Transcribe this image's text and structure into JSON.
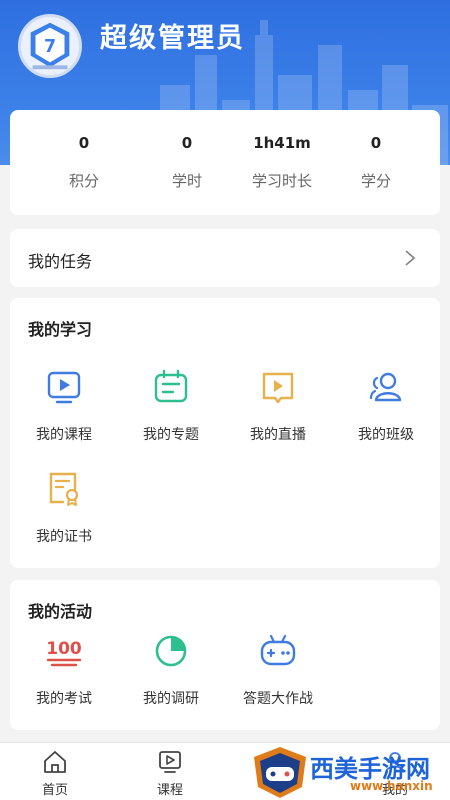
{
  "user": {
    "name": "超级管理员"
  },
  "stats": [
    {
      "value": "0",
      "label": "积分"
    },
    {
      "value": "0",
      "label": "学时"
    },
    {
      "value": "1h41m",
      "label": "学习时长"
    },
    {
      "value": "0",
      "label": "学分"
    }
  ],
  "task": {
    "title": "我的任务"
  },
  "study": {
    "title": "我的学习",
    "items": [
      {
        "label": "我的课程",
        "icon": "video-course-icon"
      },
      {
        "label": "我的专题",
        "icon": "topic-icon"
      },
      {
        "label": "我的直播",
        "icon": "live-book-icon"
      },
      {
        "label": "我的班级",
        "icon": "class-people-icon"
      },
      {
        "label": "我的证书",
        "icon": "certificate-icon"
      }
    ]
  },
  "activity": {
    "title": "我的活动",
    "items": [
      {
        "label": "我的考试",
        "icon": "exam-100-icon"
      },
      {
        "label": "我的调研",
        "icon": "survey-pie-icon"
      },
      {
        "label": "答题大作战",
        "icon": "gamepad-icon"
      }
    ]
  },
  "tabbar": [
    {
      "label": "首页",
      "icon": "home-icon"
    },
    {
      "label": "课程",
      "icon": "course-play-icon"
    },
    {
      "label": "我的",
      "icon": "profile-icon"
    }
  ],
  "watermark": {
    "text": "西美手游网",
    "url": "www.hanxin"
  },
  "colors": {
    "header_blue": "#3b7fe8",
    "icon_blue": "#3f7be0",
    "icon_green": "#2dbf8e",
    "icon_gold": "#e6b04a",
    "icon_red": "#e0504a"
  }
}
